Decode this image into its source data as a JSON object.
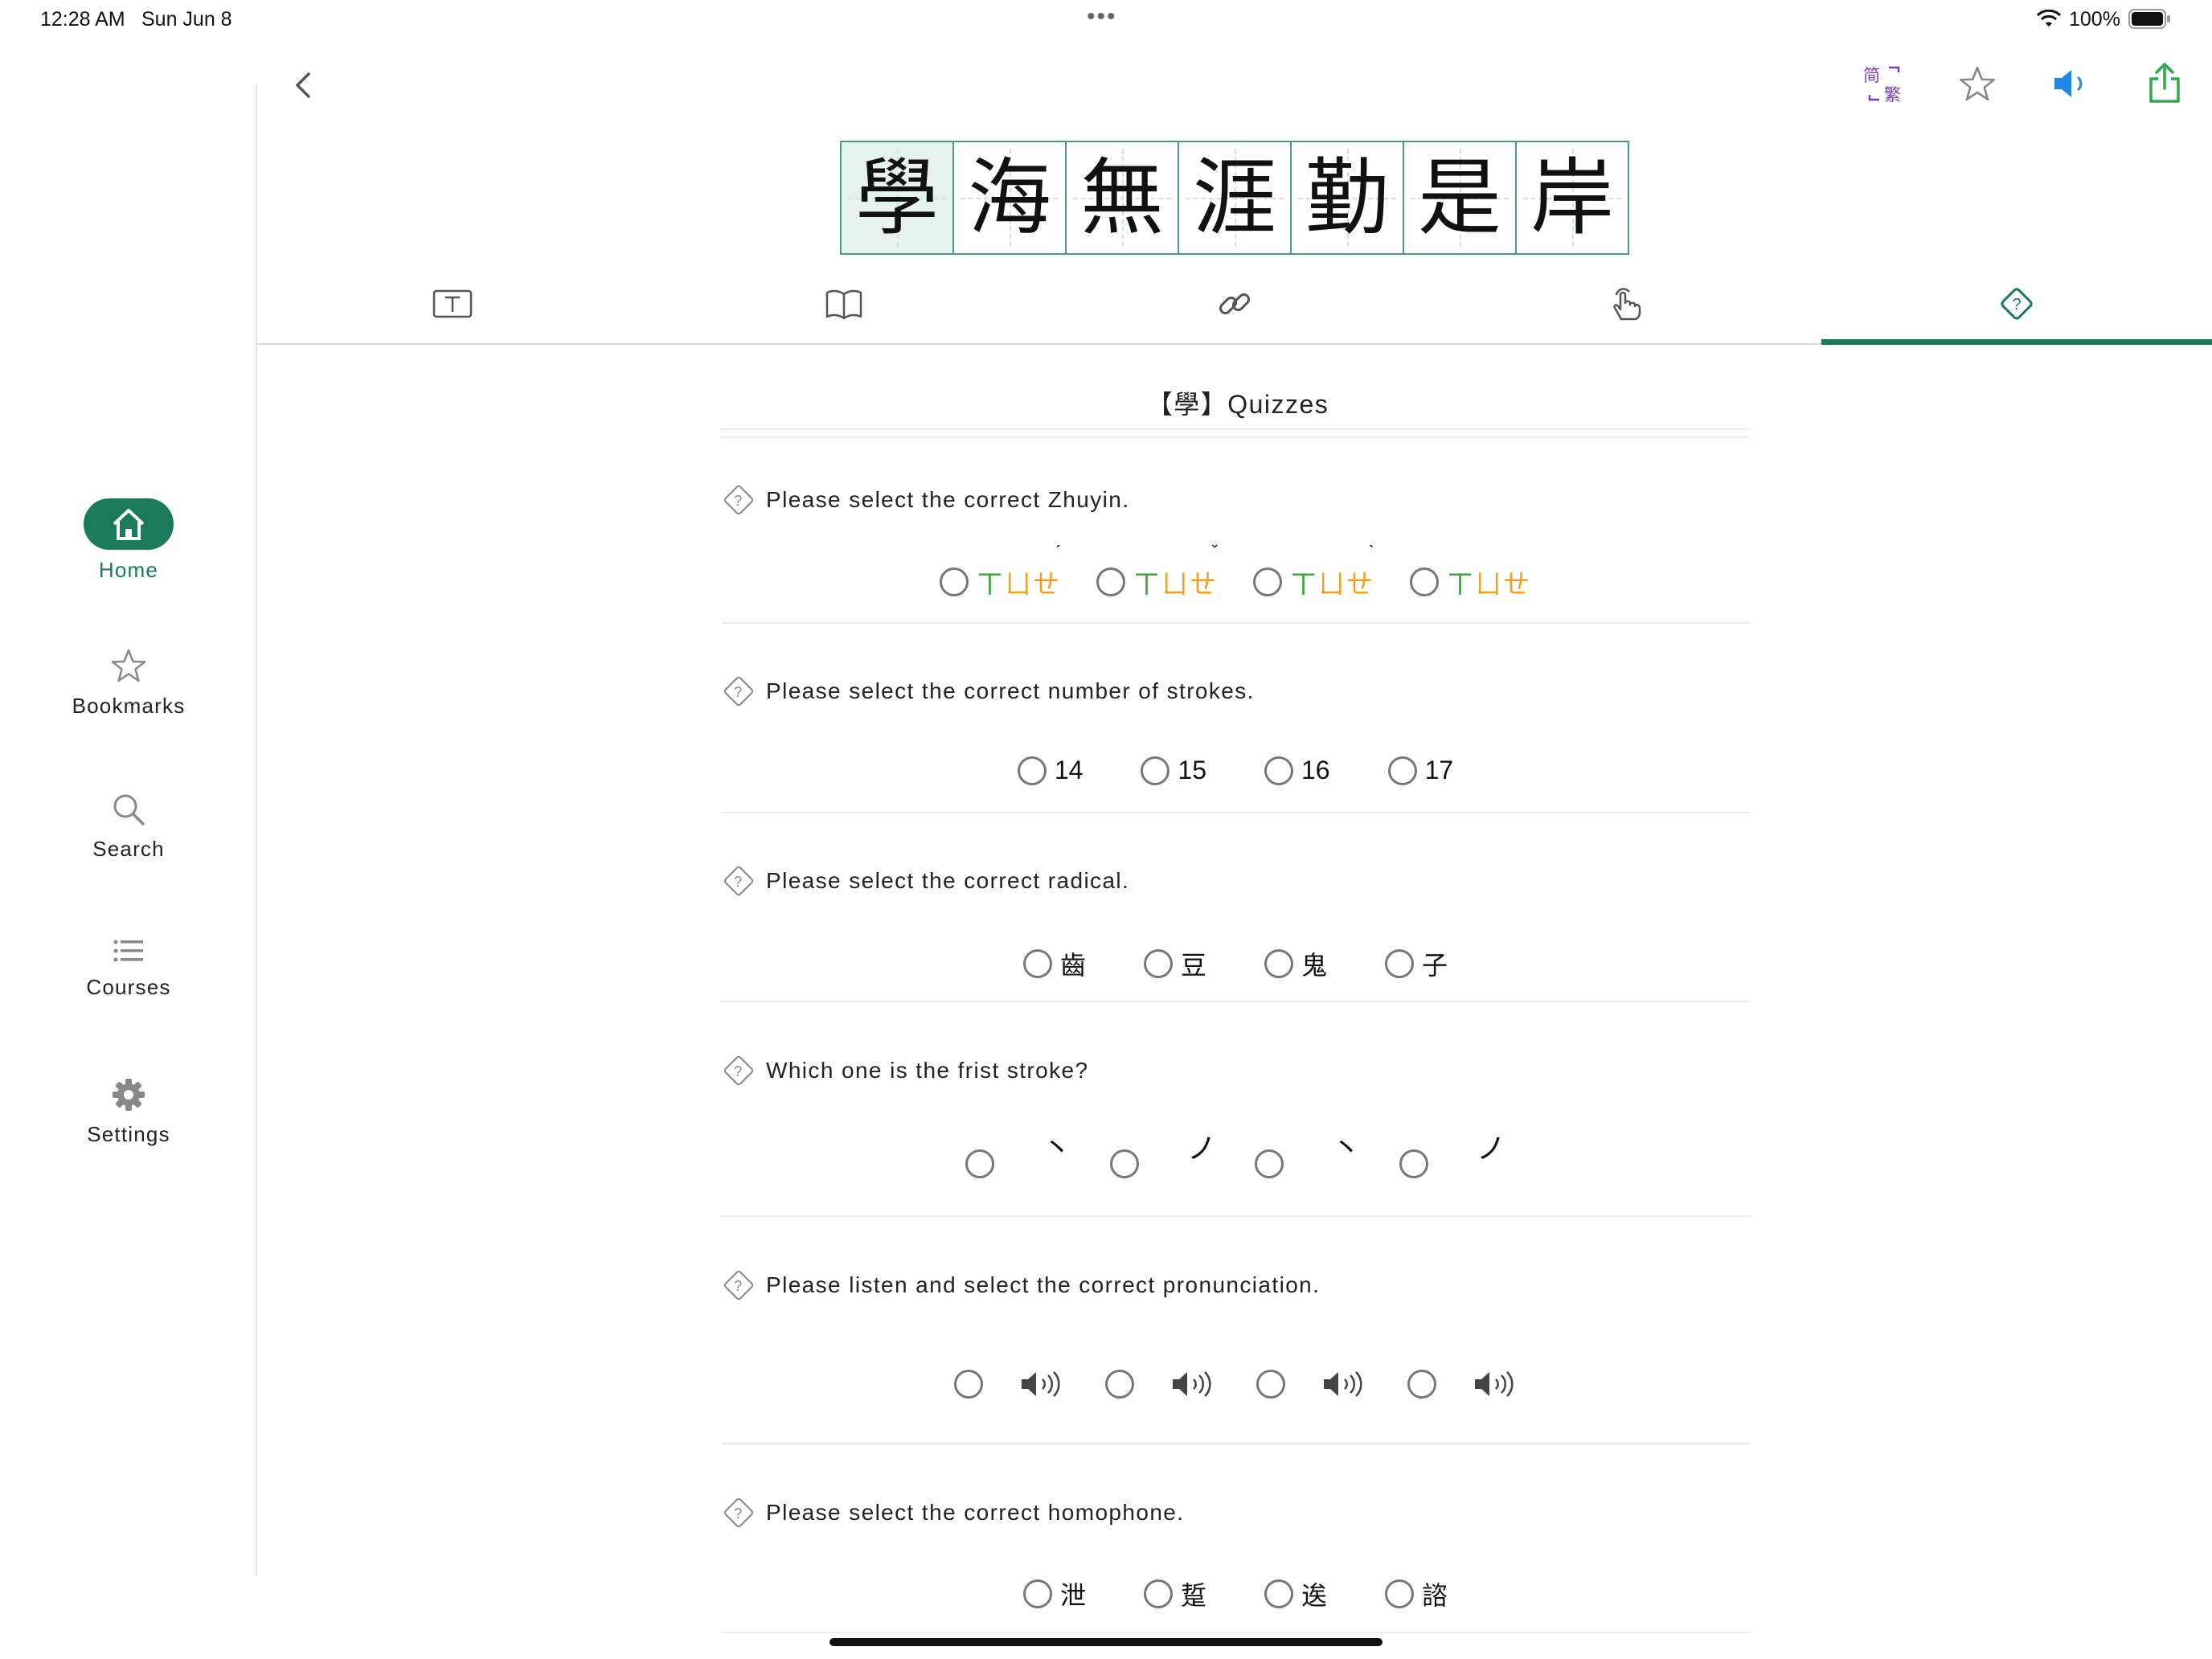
{
  "status_bar": {
    "time": "12:28 AM",
    "date": "Sun Jun 8",
    "battery": "100%"
  },
  "sidebar": {
    "items": [
      {
        "label": "Home",
        "icon": "home-icon",
        "active": true
      },
      {
        "label": "Bookmarks",
        "icon": "star-icon"
      },
      {
        "label": "Search",
        "icon": "search-icon"
      },
      {
        "label": "Courses",
        "icon": "list-icon"
      },
      {
        "label": "Settings",
        "icon": "gear-icon"
      }
    ]
  },
  "toolbar": {
    "convert_simplified": "简",
    "convert_traditional": "繁"
  },
  "phrase": {
    "characters": [
      "學",
      "海",
      "無",
      "涯",
      "勤",
      "是",
      "岸"
    ],
    "selected_index": 0
  },
  "tabs": [
    "text-box-icon",
    "book-icon",
    "link-icon",
    "hand-tap-icon",
    "quiz-icon"
  ],
  "active_tab": 4,
  "section_title": "【學】Quizzes",
  "questions": [
    {
      "prompt": "Please select the correct Zhuyin.",
      "options": [
        {
          "initial": "ㄒ",
          "medial": "ㄩ",
          "final": "ㄝ",
          "tone": "ˊ"
        },
        {
          "initial": "ㄒ",
          "medial": "ㄩ",
          "final": "ㄝ",
          "tone": "ˇ"
        },
        {
          "initial": "ㄒ",
          "medial": "ㄩ",
          "final": "ㄝ",
          "tone": "ˋ"
        },
        {
          "initial": "ㄒ",
          "medial": "ㄩ",
          "final": "ㄝ",
          "tone": ""
        }
      ]
    },
    {
      "prompt": "Please select the correct number of strokes.",
      "options": [
        "14",
        "15",
        "16",
        "17"
      ]
    },
    {
      "prompt": "Please select the correct radical.",
      "options": [
        "齒",
        "豆",
        "鬼",
        "子"
      ]
    },
    {
      "prompt": "Which one is the frist stroke?",
      "options": [
        "丶",
        "ノ",
        "丶",
        "ノ"
      ]
    },
    {
      "prompt": "Please listen and select the correct pronunciation.",
      "options": [
        "speaker-icon",
        "speaker-icon",
        "speaker-icon",
        "speaker-icon"
      ]
    },
    {
      "prompt": "Please select the correct homophone.",
      "options": [
        "泄",
        "踅",
        "逘",
        "諮"
      ]
    }
  ],
  "colors": {
    "accent": "#1a7a59",
    "zhuyin_green": "#3aa63a",
    "zhuyin_orange": "#f0a020",
    "speaker_blue": "#1e88e5",
    "share_green": "#2fa84f",
    "convert_purple": "#7a3fc0"
  }
}
